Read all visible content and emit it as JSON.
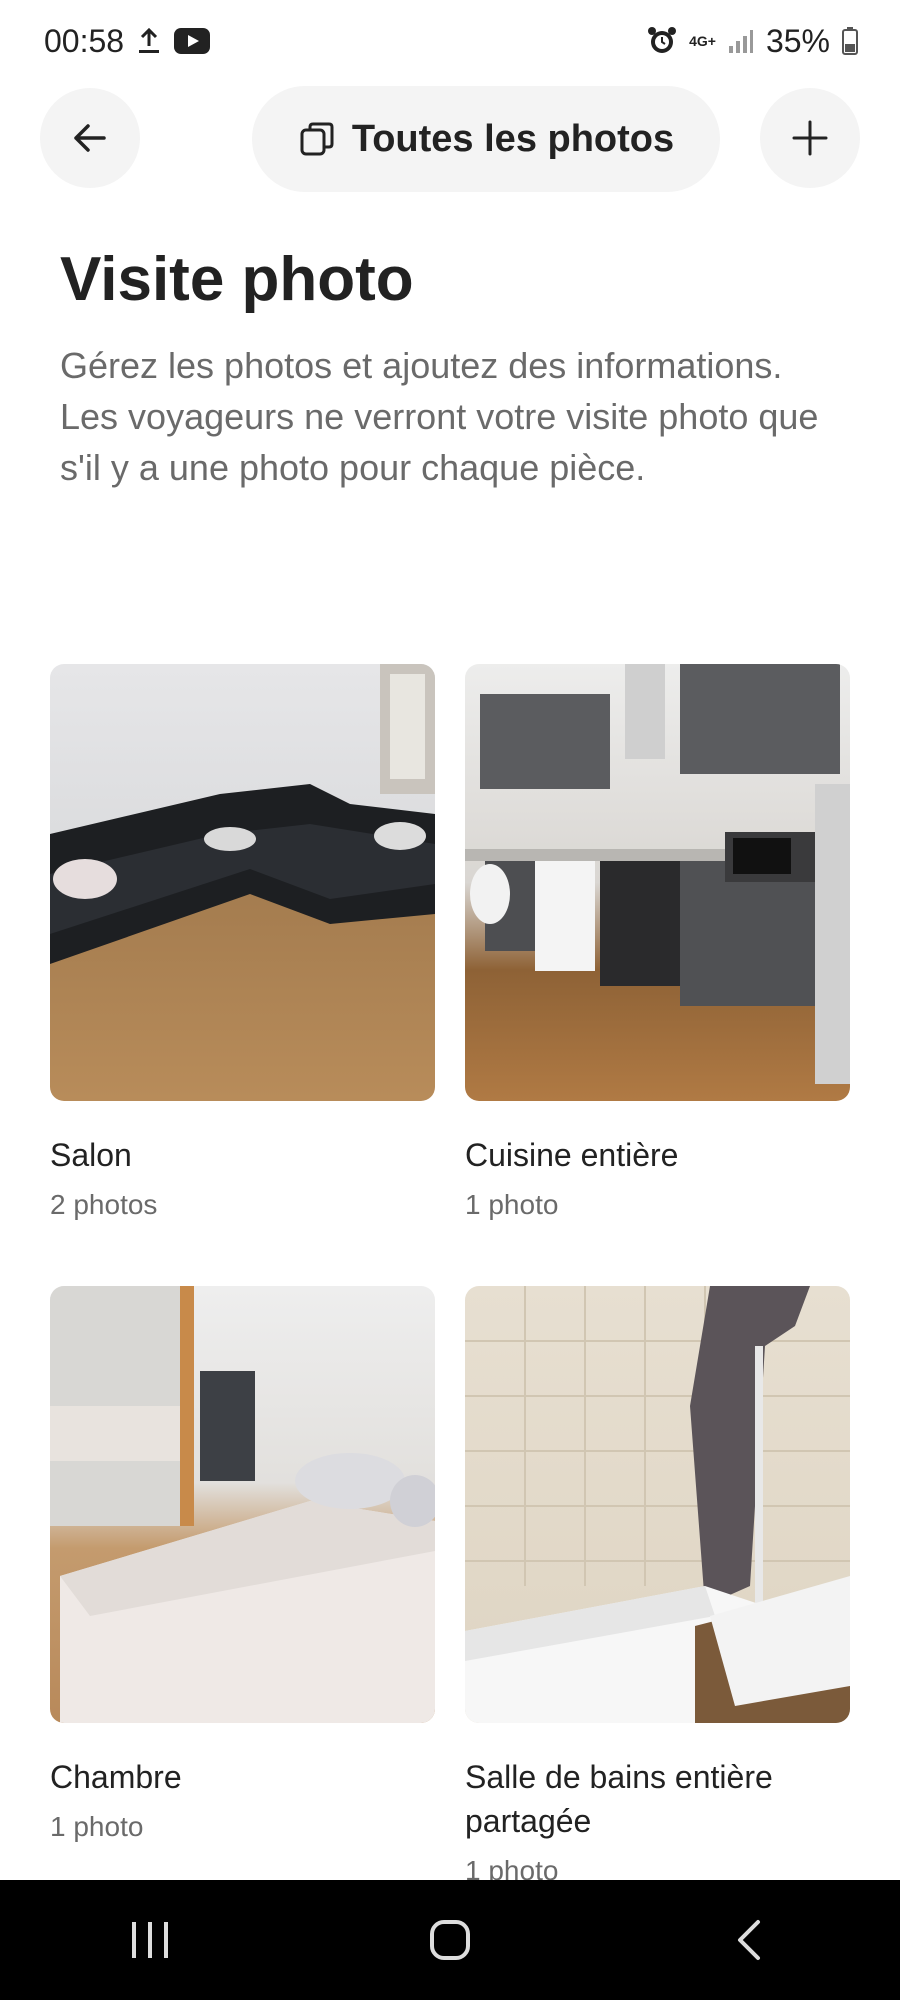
{
  "status_bar": {
    "time": "00:58",
    "battery": "35%",
    "network": "4G+"
  },
  "top_nav": {
    "all_photos_label": "Toutes les photos"
  },
  "header": {
    "title": "Visite photo",
    "description": "Gérez les photos et ajoutez des informations. Les voyageurs ne verront votre visite photo que s'il y a une photo pour chaque pièce."
  },
  "rooms": [
    {
      "name": "Salon",
      "count": "2 photos"
    },
    {
      "name": "Cuisine entière",
      "count": "1 photo"
    },
    {
      "name": "Chambre",
      "count": "1 photo"
    },
    {
      "name": "Salle de bains entière partagée",
      "count": "1 photo"
    }
  ],
  "colors": {
    "text_primary": "#222222",
    "text_secondary": "#6a6a6a",
    "button_bg": "#f4f4f4",
    "nav_bar": "#000000"
  }
}
